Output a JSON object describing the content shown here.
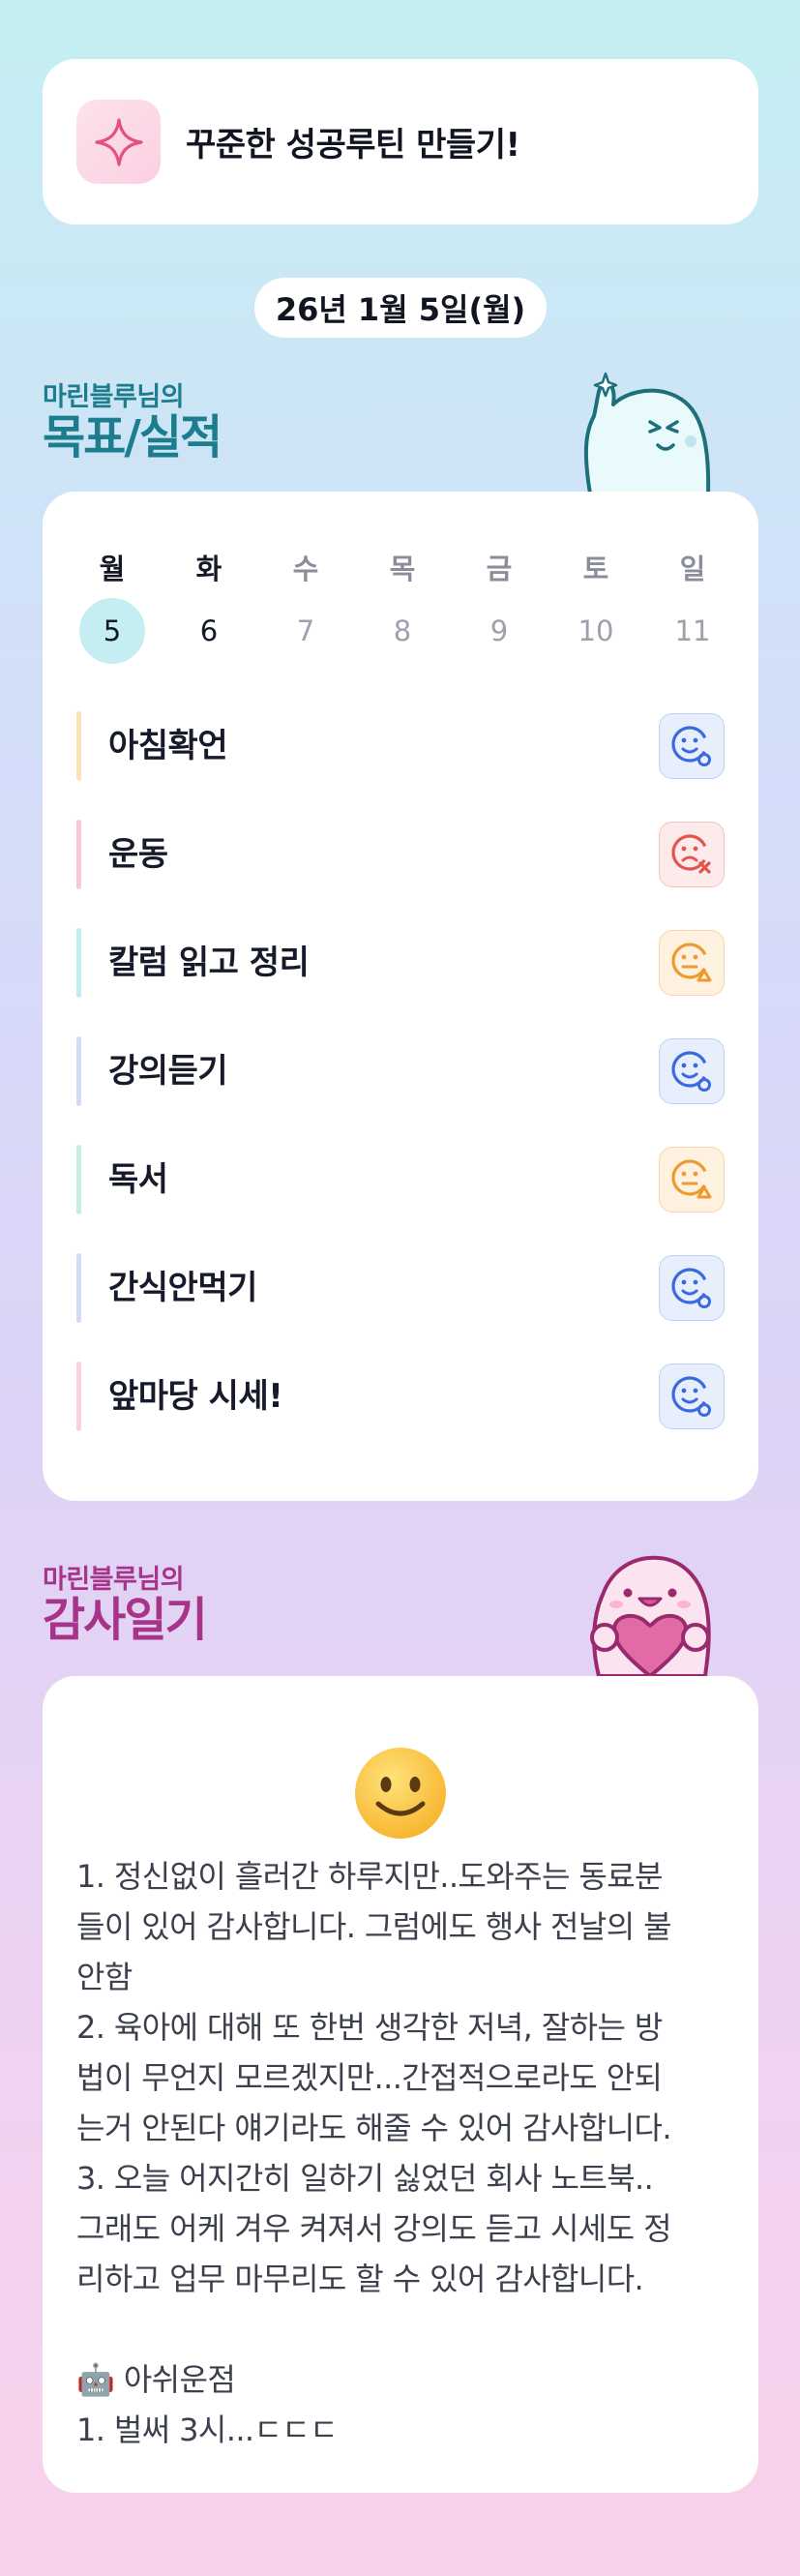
{
  "banner": {
    "icon": "sparkle-icon",
    "title": "꾸준한 성공루틴 만들기!"
  },
  "date": "26년 1월 5일(월)",
  "goals_section": {
    "subtitle": "마린블루님의",
    "title": "목표/실적"
  },
  "week": {
    "days": [
      "월",
      "화",
      "수",
      "목",
      "금",
      "토",
      "일"
    ],
    "dates": [
      "5",
      "6",
      "7",
      "8",
      "9",
      "10",
      "11"
    ],
    "selected_index": 0
  },
  "goals": [
    {
      "label": "아침확언",
      "bar_color": "#fde2b8",
      "status": "done",
      "status_icon": "smile-check-icon"
    },
    {
      "label": "운동",
      "bar_color": "#f9c6dd",
      "status": "fail",
      "status_icon": "frown-x-icon"
    },
    {
      "label": "칼럼 읽고 정리",
      "bar_color": "#c1ecf2",
      "status": "partial",
      "status_icon": "meh-triangle-icon"
    },
    {
      "label": "강의듣기",
      "bar_color": "#d3dcf6",
      "status": "done",
      "status_icon": "smile-check-icon"
    },
    {
      "label": "독서",
      "bar_color": "#c6efe0",
      "status": "partial",
      "status_icon": "meh-triangle-icon"
    },
    {
      "label": "간식안먹기",
      "bar_color": "#d3dcf6",
      "status": "done",
      "status_icon": "smile-check-icon"
    },
    {
      "label": "앞마당 시세!",
      "bar_color": "#f9d2dd",
      "status": "done",
      "status_icon": "smile-check-icon"
    }
  ],
  "status_colors": {
    "done": "#3b6ae0",
    "fail": "#e0564f",
    "partial": "#ef9a2e"
  },
  "gratitude_section": {
    "subtitle": "마린블루님의",
    "title": "감사일기"
  },
  "gratitude": {
    "mood_icon": "smiley-face-icon",
    "lines": [
      "1. 정신없이 흘러간 하루지만..도와주는 동료분",
      "들이 있어 감사합니다. 그럼에도 행사 전날의 불",
      "안함",
      "2. 육아에 대해 또 한번 생각한 저녁, 잘하는 방",
      "법이 무언지 모르겠지만...간접적으로라도 안되",
      "는거 안된다 얘기라도 해줄 수 있어 감사합니다.",
      "3. 오늘 어지간히 일하기 싫었던 회사 노트북..",
      "그래도 어케 겨우 켜져서 강의도 듣고 시세도 정",
      "리하고 업무 마무리도 할 수 있어 감사합니다.",
      "",
      "🤖 아쉬운점",
      "1. 벌써 3시...ㄷㄷㄷ"
    ]
  }
}
